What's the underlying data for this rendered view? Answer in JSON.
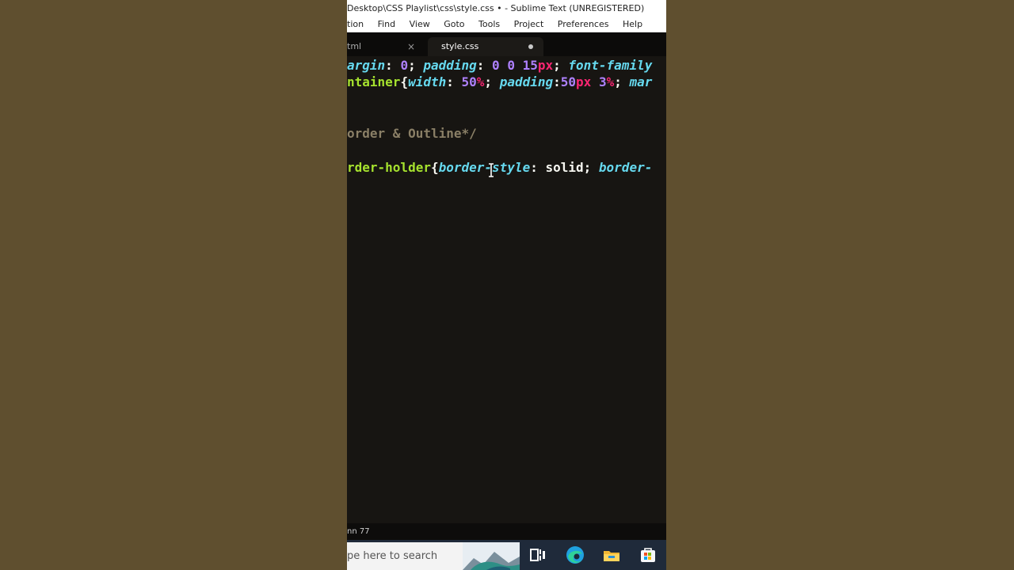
{
  "window": {
    "title": "Desktop\\CSS Playlist\\css\\style.css • - Sublime Text (UNREGISTERED)"
  },
  "menu": [
    "tion",
    "Find",
    "View",
    "Goto",
    "Tools",
    "Project",
    "Preferences",
    "Help"
  ],
  "tabs": [
    {
      "label": "tml",
      "active": false,
      "close": "×"
    },
    {
      "label": "style.css",
      "active": true
    }
  ],
  "code": {
    "line1": {
      "t1": "argin",
      "t2": ": ",
      "t3": "0",
      "t4": "; ",
      "t5": "padding",
      "t6": ": ",
      "t7": "0 0 15",
      "t8": "px",
      "t9": "; ",
      "t10": "font-family"
    },
    "line2": {
      "t1": "ntainer",
      "t2": "{",
      "t3": "width",
      "t4": ": ",
      "t5": "50",
      "t6": "%",
      "t7": "; ",
      "t8": "padding",
      "t9": ":",
      "t10": "50",
      "t11": "px",
      "t12": " ",
      "t13": "3",
      "t14": "%",
      "t15": "; ",
      "t16": "mar"
    },
    "line5": "order & Outline*/",
    "line7": {
      "t1": "rder-holder",
      "t2": "{",
      "t3": "border-style",
      "t4": ": ",
      "t5": "solid",
      "t6": "; ",
      "t7": "border-"
    }
  },
  "status": {
    "text": "nn 77"
  },
  "taskbar": {
    "search_placeholder": "pe here to search"
  },
  "colors": {
    "background": "#5f4f2f",
    "editor_bg": "#171512",
    "property": "#66d9ef",
    "number": "#ae81ff",
    "unit": "#f92672",
    "selector": "#a6e22e",
    "comment": "#8a7f66"
  },
  "icons": [
    "close-icon",
    "dirty-dot-icon",
    "text-cursor-icon",
    "task-view-icon",
    "edge-icon",
    "file-explorer-icon",
    "store-icon"
  ]
}
